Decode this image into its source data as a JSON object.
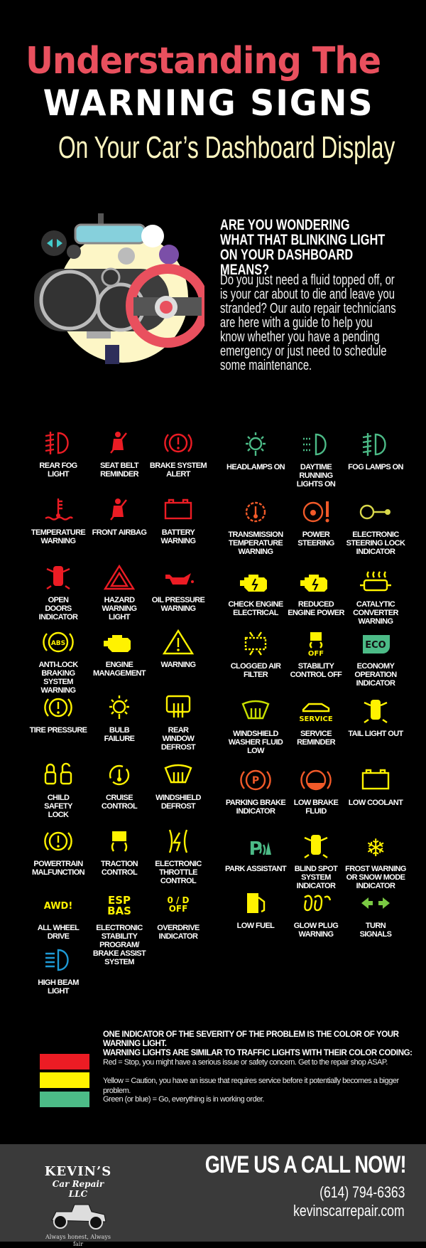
{
  "title": {
    "line1": "Understanding The",
    "line2": "WARNING SIGNS",
    "line3": "On Your Car’s Dashboard Display"
  },
  "intro": {
    "heading": "ARE YOU WONDERING WHAT THAT BLINKING LIGHT ON YOUR DASHBOARD MEANS?",
    "body": "Do you just need a fluid topped off, or is your car about to die and leave you stranded? Our auto repair technicians are here with a guide to help you know whether you have a pending emergency or just need to schedule some maintenance."
  },
  "colors": {
    "red": "#ec1c24",
    "yellow": "#fff200",
    "green": "#4cbb87",
    "orange": "#f15a29",
    "blue": "#1e9ad6",
    "lime": "#c8e000",
    "lightgreen": "#7ac943",
    "footer": "#3a3a3a",
    "title": "#e9505e"
  },
  "left_icons": [
    {
      "label": "REAR FOG\nLIGHT",
      "icon": "rear-fog-light-icon",
      "color": "#ec1c24"
    },
    {
      "label": "SEAT BELT\nREMINDER",
      "icon": "seat-belt-icon",
      "color": "#ec1c24"
    },
    {
      "label": "BRAKE SYSTEM\nALERT",
      "icon": "brake-alert-icon",
      "color": "#ec1c24"
    },
    {
      "label": "TEMPERATURE\nWARNING",
      "icon": "temperature-icon",
      "color": "#ec1c24"
    },
    {
      "label": "FRONT AIRBAG",
      "icon": "airbag-icon",
      "color": "#ec1c24"
    },
    {
      "label": "BATTERY\nWARNING",
      "icon": "battery-icon",
      "color": "#ec1c24"
    },
    {
      "label": "OPEN\nDOORS\nINDICATOR",
      "icon": "open-doors-icon",
      "color": "#ec1c24"
    },
    {
      "label": "HAZARD\nWARNING\nLIGHT",
      "icon": "hazard-icon",
      "color": "#ec1c24"
    },
    {
      "label": "OIL PRESSURE\nWARNING",
      "icon": "oil-can-icon",
      "color": "#ec1c24"
    },
    {
      "label": "ANTI-LOCK\nBRAKING\nSYSTEM\nWARNING",
      "icon": "abs-icon",
      "color": "#fff200",
      "icon_text": "ABS"
    },
    {
      "label": "ENGINE\nMANAGEMENT",
      "icon": "engine-icon",
      "color": "#fff200"
    },
    {
      "label": "WARNING",
      "icon": "warning-triangle-icon",
      "color": "#fff200"
    },
    {
      "label": "TIRE PRESSURE",
      "icon": "tire-pressure-icon",
      "color": "#fff200"
    },
    {
      "label": "BULB\nFAILURE",
      "icon": "bulb-icon",
      "color": "#fff200"
    },
    {
      "label": "REAR\nWINDOW\nDEFROST",
      "icon": "rear-defrost-icon",
      "color": "#fff200"
    },
    {
      "label": "CHILD\nSAFETY\nLOCK",
      "icon": "child-lock-icon",
      "color": "#fff200"
    },
    {
      "label": "CRUISE\nCONTROL",
      "icon": "cruise-control-icon",
      "color": "#fff200"
    },
    {
      "label": "WINDSHIELD\nDEFROST",
      "icon": "windshield-defrost-icon",
      "color": "#fff200"
    },
    {
      "label": "POWERTRAIN\nMALFUNCTION",
      "icon": "powertrain-icon",
      "color": "#fff200"
    },
    {
      "label": "TRACTION\nCONTROL",
      "icon": "traction-icon",
      "color": "#fff200"
    },
    {
      "label": "ELECTRONIC\nTHROTTLE\nCONTROL",
      "icon": "throttle-icon",
      "color": "#fff200"
    },
    {
      "label": "ALL WHEEL\nDRIVE",
      "icon": "awd-icon",
      "color": "#fff200",
      "icon_text": "AWD!"
    },
    {
      "label": "ELECTRONIC\nSTABILITY\nPROGRAM/\nBRAKE ASSIST\nSYSTEM",
      "icon": "esp-bas-icon",
      "color": "#fff200",
      "icon_text": "ESP\nBAS"
    },
    {
      "label": "OVERDRIVE\nINDICATOR",
      "icon": "overdrive-icon",
      "color": "#fff200",
      "icon_text": "0 / D\nOFF"
    },
    {
      "label": "HIGH BEAM\nLIGHT",
      "icon": "high-beam-icon",
      "color": "#1e9ad6"
    }
  ],
  "right_icons": [
    {
      "label": "HEADLAMPS ON",
      "icon": "headlamp-bulb-icon",
      "color": "#4cbb87"
    },
    {
      "label": "DAYTIME\nRUNNING\nLIGHTS ON",
      "icon": "daytime-lights-icon",
      "color": "#4cbb87"
    },
    {
      "label": "FOG LAMPS ON",
      "icon": "fog-lamp-icon",
      "color": "#4cbb87"
    },
    {
      "label": "TRANSMISSION\nTEMPERATURE\nWARNING",
      "icon": "transmission-temp-icon",
      "color": "#f15a29"
    },
    {
      "label": "POWER\nSTEERING",
      "icon": "power-steering-icon",
      "color": "#f15a29"
    },
    {
      "label": "ELECTRONIC\nSTEERING LOCK\nINDICATOR",
      "icon": "steering-lock-icon",
      "color": "#d9d84a"
    },
    {
      "label": "CHECK ENGINE\nELECTRICAL",
      "icon": "engine-electrical-icon",
      "color": "#fff200"
    },
    {
      "label": "REDUCED\nENGINE POWER",
      "icon": "engine-reduced-icon",
      "color": "#fff200"
    },
    {
      "label": "CATALYTIC\nCONVERTER\nWARNING",
      "icon": "catalytic-icon",
      "color": "#fff200"
    },
    {
      "label": "CLOGGED AIR\nFILTER",
      "icon": "air-filter-icon",
      "color": "#fff200"
    },
    {
      "label": "STABILITY\nCONTROL OFF",
      "icon": "stability-off-icon",
      "color": "#fff200",
      "icon_text": "OFF"
    },
    {
      "label": "ECONOMY\nOPERATION\nINDICATOR",
      "icon": "eco-icon",
      "color": "#4cbb87",
      "icon_text": "ECO"
    },
    {
      "label": "WINDSHIELD\nWASHER FLUID\nLOW",
      "icon": "washer-fluid-icon",
      "color": "#c8e000"
    },
    {
      "label": "SERVICE\nREMINDER",
      "icon": "service-icon",
      "color": "#fff200",
      "icon_text": "SERVICE"
    },
    {
      "label": "TAIL LIGHT OUT",
      "icon": "tail-light-icon",
      "color": "#fff200"
    },
    {
      "label": "PARKING BRAKE\nINDICATOR",
      "icon": "parking-brake-icon",
      "color": "#f15a29",
      "icon_text": "P"
    },
    {
      "label": "LOW BRAKE\nFLUID",
      "icon": "brake-fluid-icon",
      "color": "#f15a29"
    },
    {
      "label": "LOW COOLANT",
      "icon": "coolant-icon",
      "color": "#fff200"
    },
    {
      "label": "PARK ASSISTANT",
      "icon": "park-assist-icon",
      "color": "#4cbb87",
      "icon_text": "P"
    },
    {
      "label": "BLIND SPOT\nSYSTEM\nINDICATOR",
      "icon": "blind-spot-icon",
      "color": "#fff200"
    },
    {
      "label": "FROST WARNING\nOR SNOW MODE\nINDICATOR",
      "icon": "snowflake-icon",
      "color": "#fff200"
    },
    {
      "label": "LOW FUEL",
      "icon": "fuel-pump-icon",
      "color": "#fff200"
    },
    {
      "label": "GLOW PLUG\nWARNING",
      "icon": "glow-plug-icon",
      "color": "#fff200"
    },
    {
      "label": "TURN\nSIGNALS",
      "icon": "turn-signals-icon",
      "color": "#7ac943"
    }
  ],
  "legend": {
    "heading": "ONE INDICATOR OF THE SEVERITY OF THE PROBLEM IS THE COLOR OF YOUR WARNING LIGHT.\nWARNING LIGHTS ARE SIMILAR TO TRAFFIC LIGHTS WITH THEIR COLOR CODING:",
    "items": [
      {
        "color": "#ec1c24",
        "text": "Red = Stop, you might have a serious issue or safety concern. Get to the repair shop ASAP."
      },
      {
        "color": "#fff200",
        "text": "Yellow = Caution, you have an issue that requires service before it potentially becomes a bigger problem."
      },
      {
        "color": "#4cbb87",
        "text": "Green (or blue) = Go, everything is in working order."
      }
    ]
  },
  "footer": {
    "logo_name": "KEVIN’S",
    "logo_sub": "Car Repair LLC",
    "logo_tagline": "Always honest, Always fair",
    "cta": "GIVE US A CALL NOW!",
    "phone": "(614) 794-6363",
    "website": "kevinscarrepair.com"
  }
}
